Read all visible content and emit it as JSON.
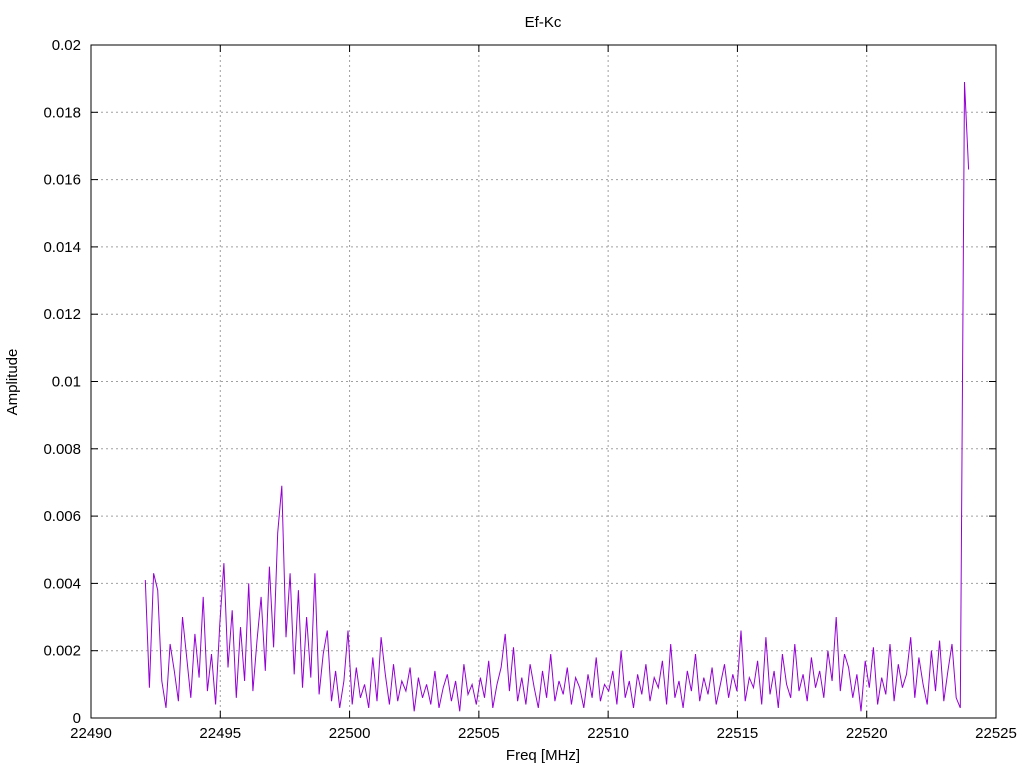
{
  "chart_data": {
    "type": "line",
    "title": "Ef-Kc",
    "xlabel": "Freq [MHz]",
    "ylabel": "Amplitude",
    "xlim": [
      22490,
      22525
    ],
    "ylim": [
      0,
      0.02
    ],
    "xticks": [
      "22490",
      "22495",
      "22500",
      "22505",
      "22510",
      "22515",
      "22520",
      "22525"
    ],
    "xtick_values": [
      22490,
      22495,
      22500,
      22505,
      22510,
      22515,
      22520,
      22525
    ],
    "yticks": [
      "0",
      "0.002",
      "0.004",
      "0.006",
      "0.008",
      "0.01",
      "0.012",
      "0.014",
      "0.016",
      "0.018",
      "0.02"
    ],
    "ytick_values": [
      0,
      0.002,
      0.004,
      0.006,
      0.008,
      0.01,
      0.012,
      0.014,
      0.016,
      0.018,
      0.02
    ],
    "grid": true,
    "legend": "none",
    "series": [
      {
        "name": "Ef-Kc",
        "color": "#9400d3",
        "x_start": 22492.1,
        "x_step": 0.16,
        "values": [
          0.0041,
          0.0009,
          0.0043,
          0.0038,
          0.0011,
          0.0003,
          0.0022,
          0.0014,
          0.0005,
          0.003,
          0.0018,
          0.0006,
          0.0025,
          0.0012,
          0.0036,
          0.0008,
          0.0019,
          0.0004,
          0.0028,
          0.0046,
          0.0015,
          0.0032,
          0.0006,
          0.0027,
          0.0011,
          0.004,
          0.0008,
          0.0023,
          0.0036,
          0.0014,
          0.0045,
          0.0021,
          0.0055,
          0.0069,
          0.0024,
          0.0043,
          0.0013,
          0.0038,
          0.0009,
          0.003,
          0.0012,
          0.0043,
          0.0007,
          0.0019,
          0.0026,
          0.0005,
          0.0014,
          0.0003,
          0.0011,
          0.0026,
          0.0004,
          0.0015,
          0.0006,
          0.001,
          0.0003,
          0.0018,
          0.0005,
          0.0024,
          0.0013,
          0.0004,
          0.0016,
          0.0005,
          0.0011,
          0.0008,
          0.0015,
          0.0002,
          0.0012,
          0.0006,
          0.001,
          0.0004,
          0.0014,
          0.0003,
          0.0009,
          0.0013,
          0.0005,
          0.0011,
          0.0002,
          0.0016,
          0.0007,
          0.001,
          0.0004,
          0.0012,
          0.0006,
          0.0017,
          0.0003,
          0.001,
          0.0015,
          0.0025,
          0.0008,
          0.0021,
          0.0005,
          0.0012,
          0.0004,
          0.0016,
          0.0009,
          0.0003,
          0.0014,
          0.0006,
          0.0019,
          0.0005,
          0.0011,
          0.0007,
          0.0015,
          0.0004,
          0.0012,
          0.0009,
          0.0003,
          0.0013,
          0.0006,
          0.0018,
          0.0005,
          0.001,
          0.0008,
          0.0014,
          0.0004,
          0.002,
          0.0006,
          0.0011,
          0.0003,
          0.0013,
          0.0007,
          0.0016,
          0.0005,
          0.0012,
          0.0009,
          0.0017,
          0.0004,
          0.0022,
          0.0006,
          0.0011,
          0.0003,
          0.0014,
          0.0008,
          0.0019,
          0.0005,
          0.0012,
          0.0007,
          0.0015,
          0.0004,
          0.001,
          0.0016,
          0.0006,
          0.0013,
          0.0008,
          0.0026,
          0.0005,
          0.0012,
          0.0009,
          0.0017,
          0.0004,
          0.0024,
          0.0007,
          0.0014,
          0.0003,
          0.0019,
          0.001,
          0.0006,
          0.0022,
          0.0008,
          0.0013,
          0.0005,
          0.0018,
          0.0009,
          0.0014,
          0.0006,
          0.002,
          0.0011,
          0.003,
          0.0008,
          0.0019,
          0.0015,
          0.0006,
          0.0013,
          0.0002,
          0.0017,
          0.0009,
          0.0021,
          0.0004,
          0.0012,
          0.0007,
          0.0022,
          0.0005,
          0.0016,
          0.0009,
          0.0013,
          0.0024,
          0.0006,
          0.0018,
          0.001,
          0.0004,
          0.002,
          0.0008,
          0.0023,
          0.0005,
          0.0014,
          0.0022,
          0.0006,
          0.0003,
          0.0189,
          0.0163
        ]
      }
    ]
  }
}
